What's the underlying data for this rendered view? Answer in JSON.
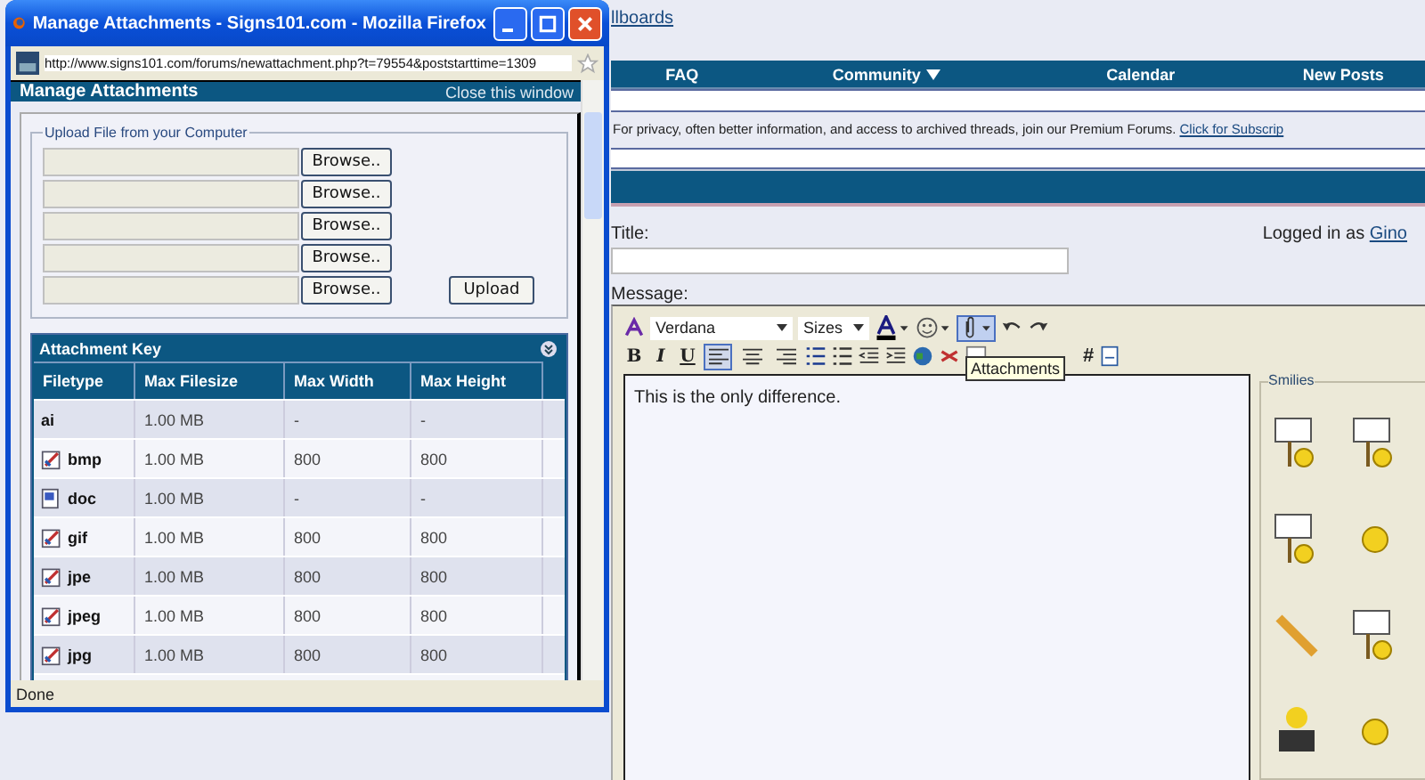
{
  "forum": {
    "top_link": "llboards",
    "nav": [
      {
        "label": "FAQ",
        "dropdown": false
      },
      {
        "label": "Community",
        "dropdown": true
      },
      {
        "label": "Calendar",
        "dropdown": false
      },
      {
        "label": "New Posts",
        "dropdown": false
      }
    ],
    "notice": {
      "text": "For privacy, often better information, and access to archived threads, join our Premium Forums.",
      "link": "Click for Subscrip"
    },
    "title_label": "Title:",
    "logged_in": "Logged in as",
    "user": "Gino",
    "message_label": "Message:",
    "editor": {
      "font": "Verdana",
      "size": "Sizes",
      "format_buttons": [
        "B",
        "I",
        "U"
      ],
      "align": [
        {
          "kind": "left",
          "selected": true
        },
        {
          "kind": "center",
          "selected": false
        },
        {
          "kind": "right",
          "selected": false
        }
      ],
      "attach_active": true,
      "hash": "#",
      "tooltip": "Attachments",
      "text": "This is the only difference."
    },
    "smilies": {
      "legend": "Smilies",
      "items": [
        {
          "kind": "sign"
        },
        {
          "kind": "sign"
        },
        {
          "kind": "sign"
        },
        {
          "kind": "face"
        },
        {
          "kind": "pencil"
        },
        {
          "kind": "sign"
        },
        {
          "kind": "cool"
        },
        {
          "kind": "face"
        }
      ]
    }
  },
  "popup": {
    "title": "Manage Attachments - Signs101.com - Mozilla Firefox",
    "url": "http://www.signs101.com/forums/newattachment.php?t=79554&poststarttime=1309",
    "header": "Manage Attachments",
    "close_link": "Close this window",
    "upload_legend": "Upload File from your Computer",
    "browse_buttons": [
      "Browse..",
      "Browse..",
      "Browse..",
      "Browse..",
      "Browse.."
    ],
    "upload_button": "Upload",
    "key_title": "Attachment Key",
    "columns": [
      "Filetype",
      "Max Filesize",
      "Max Width",
      "Max Height"
    ],
    "rows": [
      {
        "kind": "none",
        "cells": [
          "ai",
          "1.00 MB",
          "-",
          "-"
        ]
      },
      {
        "kind": "image",
        "cells": [
          "bmp",
          "1.00 MB",
          "800",
          "800"
        ]
      },
      {
        "kind": "doc",
        "cells": [
          "doc",
          "1.00 MB",
          "-",
          "-"
        ]
      },
      {
        "kind": "image",
        "cells": [
          "gif",
          "1.00 MB",
          "800",
          "800"
        ]
      },
      {
        "kind": "image",
        "cells": [
          "jpe",
          "1.00 MB",
          "800",
          "800"
        ]
      },
      {
        "kind": "image",
        "cells": [
          "jpeg",
          "1.00 MB",
          "800",
          "800"
        ]
      },
      {
        "kind": "image",
        "cells": [
          "jpg",
          "1.00 MB",
          "800",
          "800"
        ]
      }
    ],
    "status": "Done"
  }
}
